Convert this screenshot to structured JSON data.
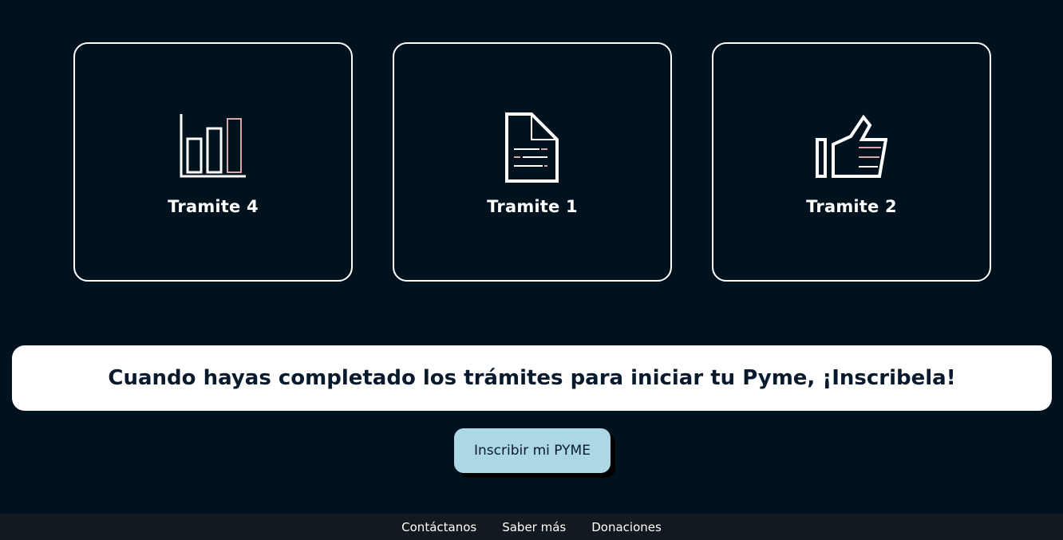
{
  "cards": [
    {
      "label": "Tramite 4",
      "icon": "bar-chart-icon"
    },
    {
      "label": "Tramite 1",
      "icon": "document-icon"
    },
    {
      "label": "Tramite 2",
      "icon": "thumbs-up-icon"
    }
  ],
  "banner": {
    "text": "Cuando hayas completado los trámites para iniciar tu Pyme, ¡Inscribela!"
  },
  "cta": {
    "label": "Inscribir mi PYME"
  },
  "footer": {
    "links": [
      "Contáctanos",
      "Saber más",
      "Donaciones"
    ]
  },
  "colors": {
    "background": "#00121d",
    "card_border": "#ffffff",
    "accent_pink": "#d8a8a8",
    "cta_background": "#acd8e6",
    "footer_background": "#121a20"
  }
}
